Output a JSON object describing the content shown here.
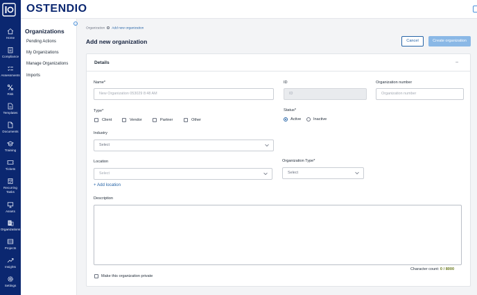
{
  "app": {
    "brand": "OSTENDIO"
  },
  "rail": [
    {
      "label": "Home",
      "icon": "home-icon"
    },
    {
      "label": "Compliance",
      "icon": "building-icon"
    },
    {
      "label": "Assessments",
      "icon": "checklist-icon"
    },
    {
      "label": "Risk",
      "icon": "risk-icon"
    },
    {
      "label": "Templates",
      "icon": "template-icon"
    },
    {
      "label": "Documents",
      "icon": "document-icon"
    },
    {
      "label": "Training",
      "icon": "graduation-icon"
    },
    {
      "label": "Tickets",
      "icon": "ticket-icon"
    },
    {
      "label": "Recurring",
      "label2": "Tasks",
      "icon": "recurring-icon"
    },
    {
      "label": "Assets",
      "icon": "monitor-icon"
    },
    {
      "label": "Organizations",
      "icon": "organization-icon"
    },
    {
      "label": "Projects",
      "icon": "projects-icon"
    },
    {
      "label": "Insights",
      "icon": "insights-icon"
    },
    {
      "label": "Settings",
      "icon": "settings-icon"
    }
  ],
  "submenu": {
    "title": "Organizations",
    "items": [
      "Pending Actions",
      "My Organizations",
      "Manage Organizations",
      "Imports"
    ]
  },
  "breadcrumb": {
    "root": "Organization",
    "current": "Add new organization"
  },
  "page": {
    "title": "Add new organization",
    "cancel_label": "Cancel",
    "create_label": "Create organization"
  },
  "details": {
    "title": "Details",
    "name": {
      "label": "Name*",
      "placeholder": "New Organization 053029 8:48 AM"
    },
    "id": {
      "label": "ID",
      "placeholder": "ID"
    },
    "orgnum": {
      "label": "Organization number",
      "placeholder": "Organization number"
    },
    "type": {
      "label": "Type*",
      "options": [
        "Client",
        "Vendor",
        "Partner",
        "Other"
      ]
    },
    "status": {
      "label": "Status*",
      "options": [
        "Active",
        "Inactive"
      ],
      "selected": "Active"
    },
    "industry": {
      "label": "Industry",
      "placeholder": "Select"
    },
    "location": {
      "label": "Location",
      "placeholder": "Select",
      "add_label": "+ Add location"
    },
    "org_type": {
      "label": "Organization Type*",
      "placeholder": "Select"
    },
    "description": {
      "label": "Description"
    },
    "char_count": {
      "label": "Character count:",
      "value": "0 / 8000"
    },
    "private_label": "Make this organization private"
  },
  "colors": {
    "rail": "#0b2770",
    "accent": "#2563a6",
    "create_button": "#8ab8e6"
  }
}
